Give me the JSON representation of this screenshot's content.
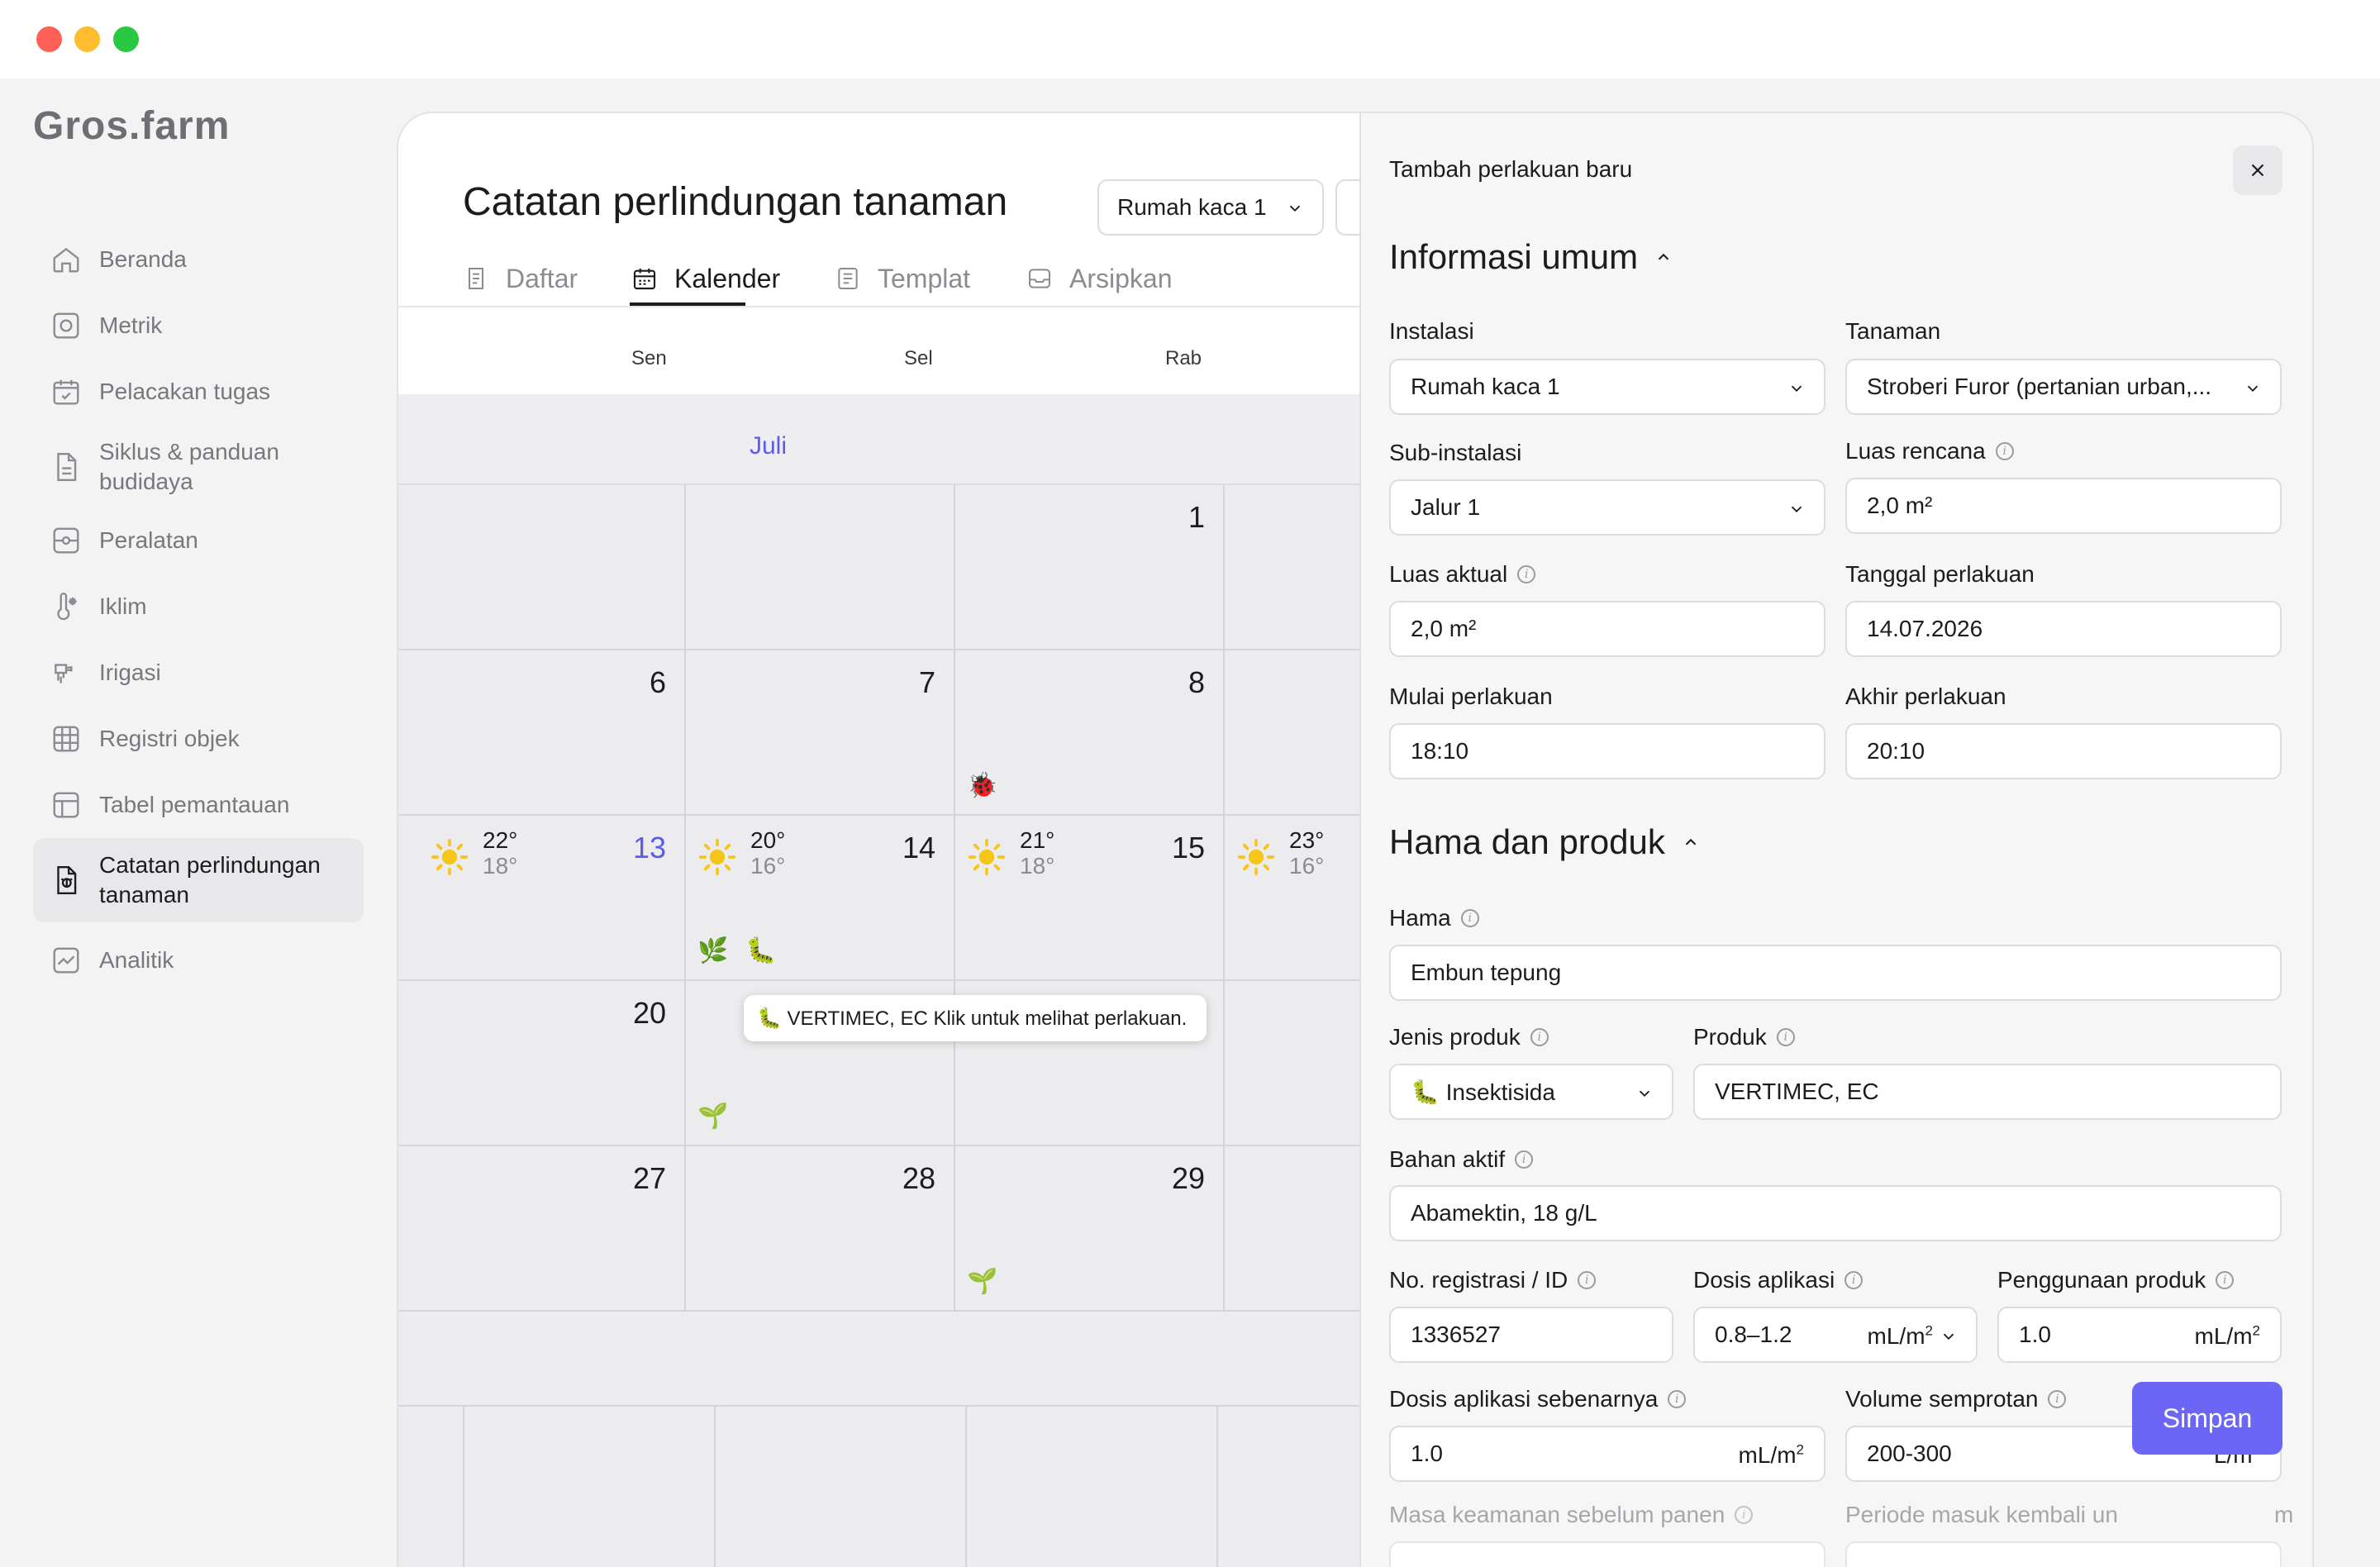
{
  "window": {
    "controls": [
      "close",
      "minimize",
      "maximize"
    ]
  },
  "brand": {
    "logo": "Gros.farm"
  },
  "sidebar": {
    "items": [
      {
        "label": "Beranda",
        "icon": "home-icon"
      },
      {
        "label": "Metrik",
        "icon": "metrics-icon"
      },
      {
        "label": "Pelacakan tugas",
        "icon": "task-icon"
      },
      {
        "label": "Siklus & panduan budidaya",
        "icon": "document-icon"
      },
      {
        "label": "Peralatan",
        "icon": "equipment-icon"
      },
      {
        "label": "Iklim",
        "icon": "climate-icon"
      },
      {
        "label": "Irigasi",
        "icon": "irrigation-icon"
      },
      {
        "label": "Registri objek",
        "icon": "grid-icon"
      },
      {
        "label": "Tabel pemantauan",
        "icon": "table-icon"
      },
      {
        "label": "Catatan perlindungan tanaman",
        "icon": "protection-icon",
        "active": true
      },
      {
        "label": "Analitik",
        "icon": "analytics-icon"
      }
    ]
  },
  "main": {
    "title": "Catatan perlindungan tanaman",
    "location_select": "Rumah kaca 1",
    "tabs": [
      {
        "label": "Daftar",
        "icon": "list-icon"
      },
      {
        "label": "Kalender",
        "icon": "calendar-icon",
        "active": true
      },
      {
        "label": "Templat",
        "icon": "template-icon"
      },
      {
        "label": "Arsipkan",
        "icon": "archive-icon"
      }
    ]
  },
  "calendar": {
    "day_headers": [
      "Sen",
      "Sel",
      "Rab"
    ],
    "month": "Juli",
    "rows": [
      {
        "dates": [
          "",
          "",
          "1",
          ""
        ]
      },
      {
        "dates": [
          "6",
          "7",
          "8",
          ""
        ]
      },
      {
        "dates": [
          "13",
          "14",
          "15",
          ""
        ],
        "weather": [
          {
            "hi": "22°",
            "lo": "18°"
          },
          {
            "hi": "20°",
            "lo": "16°"
          },
          {
            "hi": "21°",
            "lo": "18°"
          },
          {
            "hi": "23°",
            "lo": "16°"
          }
        ]
      },
      {
        "dates": [
          "20",
          "",
          "",
          ""
        ]
      },
      {
        "dates": [
          "27",
          "28",
          "29",
          ""
        ]
      }
    ],
    "today": "13",
    "events": [
      "🐞",
      "🌿",
      "🐛",
      "🌱",
      "🌱"
    ],
    "tooltip": "🐛 VERTIMEC, EC Klik untuk melihat perlakuan."
  },
  "drawer": {
    "title": "Tambah perlakuan baru",
    "general": {
      "title": "Informasi umum",
      "installation": {
        "label": "Instalasi",
        "value": "Rumah kaca 1"
      },
      "plant": {
        "label": "Tanaman",
        "value": "Stroberi Furor (pertanian urban,..."
      },
      "sub_installation": {
        "label": "Sub-instalasi",
        "value": "Jalur 1"
      },
      "planned_area": {
        "label": "Luas rencana",
        "value": "2,0 m²"
      },
      "actual_area": {
        "label": "Luas aktual",
        "value": "2,0 m²"
      },
      "treatment_date": {
        "label": "Tanggal perlakuan",
        "value": "14.07.2026"
      },
      "start": {
        "label": "Mulai perlakuan",
        "value": "18:10"
      },
      "end": {
        "label": "Akhir perlakuan",
        "value": "20:10"
      }
    },
    "pests": {
      "title": "Hama dan produk",
      "pest": {
        "label": "Hama",
        "value": "Embun tepung"
      },
      "product_type": {
        "label": "Jenis produk",
        "value": "🐛 Insektisida"
      },
      "product": {
        "label": "Produk",
        "value": "VERTIMEC, EC"
      },
      "active_ingredient": {
        "label": "Bahan aktif",
        "value": "Abamektin, 18 g/L"
      },
      "registration": {
        "label": "No. registrasi / ID",
        "value": "1336527"
      },
      "dose": {
        "label": "Dosis aplikasi",
        "value": "0.8–1.2",
        "unit": "mL/m"
      },
      "usage": {
        "label": "Penggunaan produk",
        "value": "1.0",
        "unit": "mL/m"
      },
      "actual_dose": {
        "label": "Dosis aplikasi sebenarnya",
        "value": "1.0",
        "unit": "mL/m"
      },
      "spray_volume": {
        "label": "Volume semprotan",
        "value": "200-300",
        "unit": "L/m"
      },
      "preharvest": {
        "label": "Masa keamanan sebelum panen"
      },
      "reentry": {
        "label": "Periode masuk kembali un",
        "label_tail": "m"
      },
      "unit_sup": "2"
    },
    "save_label": "Simpan"
  },
  "colors": {
    "accent": "#5b5bf0",
    "save_button": "#6b66f5",
    "sun": "#f5c518"
  }
}
